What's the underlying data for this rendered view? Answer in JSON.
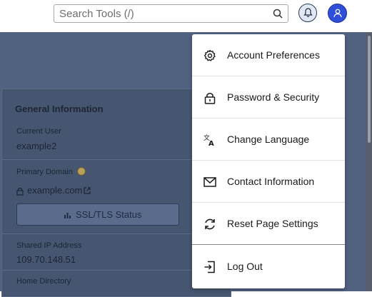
{
  "header": {
    "search_placeholder": "Search Tools (/)",
    "search_icon": "search-icon",
    "notifications_icon": "bell-icon",
    "user_icon": "user-icon"
  },
  "general_info": {
    "title": "General Information",
    "current_user_label": "Current User",
    "current_user_value": "example2",
    "primary_domain_label": "Primary Domain",
    "primary_domain_value": "example.com",
    "ssl_button": "SSL/TLS Status",
    "shared_ip_label": "Shared IP Address",
    "shared_ip_value": "109.70.148.51",
    "home_dir_label": "Home Directory"
  },
  "user_menu": {
    "items": [
      {
        "label": "Account Preferences",
        "icon": "gear-icon"
      },
      {
        "label": "Password & Security",
        "icon": "lock-icon"
      },
      {
        "label": "Change Language",
        "icon": "language-icon"
      },
      {
        "label": "Contact Information",
        "icon": "envelope-icon"
      },
      {
        "label": "Reset Page Settings",
        "icon": "refresh-icon"
      },
      {
        "label": "Log Out",
        "icon": "logout-icon"
      }
    ]
  },
  "colors": {
    "overlay_background": "#516180",
    "avatar": "#2f4fd8",
    "menu_background": "#ffffff"
  }
}
